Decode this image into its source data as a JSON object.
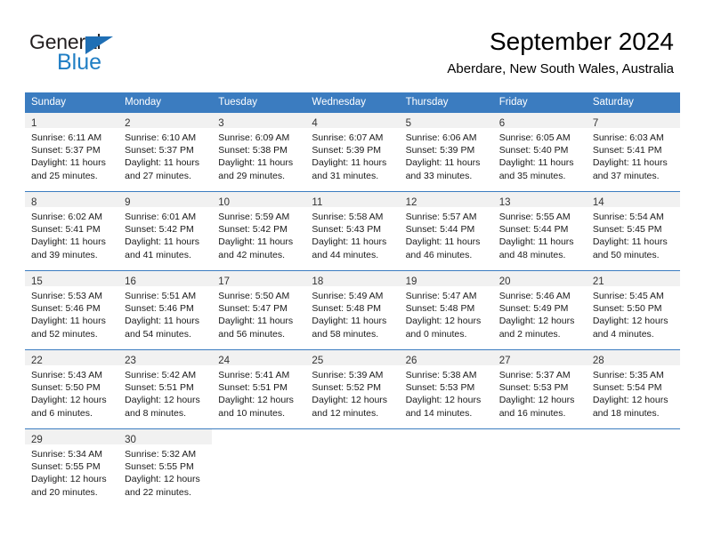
{
  "brand": {
    "name_part1": "General",
    "name_part2": "Blue",
    "triangle_icon": "triangle-icon",
    "accent_color": "#1f7ec4"
  },
  "header": {
    "month_title": "September 2024",
    "location": "Aberdare, New South Wales, Australia"
  },
  "calendar": {
    "header_bg": "#3b7cc0",
    "day_band_bg": "#f1f1f1",
    "weekday_headers": [
      "Sunday",
      "Monday",
      "Tuesday",
      "Wednesday",
      "Thursday",
      "Friday",
      "Saturday"
    ],
    "weeks": [
      [
        {
          "day": "1",
          "sunrise": "Sunrise: 6:11 AM",
          "sunset": "Sunset: 5:37 PM",
          "daylight_line1": "Daylight: 11 hours",
          "daylight_line2": "and 25 minutes."
        },
        {
          "day": "2",
          "sunrise": "Sunrise: 6:10 AM",
          "sunset": "Sunset: 5:37 PM",
          "daylight_line1": "Daylight: 11 hours",
          "daylight_line2": "and 27 minutes."
        },
        {
          "day": "3",
          "sunrise": "Sunrise: 6:09 AM",
          "sunset": "Sunset: 5:38 PM",
          "daylight_line1": "Daylight: 11 hours",
          "daylight_line2": "and 29 minutes."
        },
        {
          "day": "4",
          "sunrise": "Sunrise: 6:07 AM",
          "sunset": "Sunset: 5:39 PM",
          "daylight_line1": "Daylight: 11 hours",
          "daylight_line2": "and 31 minutes."
        },
        {
          "day": "5",
          "sunrise": "Sunrise: 6:06 AM",
          "sunset": "Sunset: 5:39 PM",
          "daylight_line1": "Daylight: 11 hours",
          "daylight_line2": "and 33 minutes."
        },
        {
          "day": "6",
          "sunrise": "Sunrise: 6:05 AM",
          "sunset": "Sunset: 5:40 PM",
          "daylight_line1": "Daylight: 11 hours",
          "daylight_line2": "and 35 minutes."
        },
        {
          "day": "7",
          "sunrise": "Sunrise: 6:03 AM",
          "sunset": "Sunset: 5:41 PM",
          "daylight_line1": "Daylight: 11 hours",
          "daylight_line2": "and 37 minutes."
        }
      ],
      [
        {
          "day": "8",
          "sunrise": "Sunrise: 6:02 AM",
          "sunset": "Sunset: 5:41 PM",
          "daylight_line1": "Daylight: 11 hours",
          "daylight_line2": "and 39 minutes."
        },
        {
          "day": "9",
          "sunrise": "Sunrise: 6:01 AM",
          "sunset": "Sunset: 5:42 PM",
          "daylight_line1": "Daylight: 11 hours",
          "daylight_line2": "and 41 minutes."
        },
        {
          "day": "10",
          "sunrise": "Sunrise: 5:59 AM",
          "sunset": "Sunset: 5:42 PM",
          "daylight_line1": "Daylight: 11 hours",
          "daylight_line2": "and 42 minutes."
        },
        {
          "day": "11",
          "sunrise": "Sunrise: 5:58 AM",
          "sunset": "Sunset: 5:43 PM",
          "daylight_line1": "Daylight: 11 hours",
          "daylight_line2": "and 44 minutes."
        },
        {
          "day": "12",
          "sunrise": "Sunrise: 5:57 AM",
          "sunset": "Sunset: 5:44 PM",
          "daylight_line1": "Daylight: 11 hours",
          "daylight_line2": "and 46 minutes."
        },
        {
          "day": "13",
          "sunrise": "Sunrise: 5:55 AM",
          "sunset": "Sunset: 5:44 PM",
          "daylight_line1": "Daylight: 11 hours",
          "daylight_line2": "and 48 minutes."
        },
        {
          "day": "14",
          "sunrise": "Sunrise: 5:54 AM",
          "sunset": "Sunset: 5:45 PM",
          "daylight_line1": "Daylight: 11 hours",
          "daylight_line2": "and 50 minutes."
        }
      ],
      [
        {
          "day": "15",
          "sunrise": "Sunrise: 5:53 AM",
          "sunset": "Sunset: 5:46 PM",
          "daylight_line1": "Daylight: 11 hours",
          "daylight_line2": "and 52 minutes."
        },
        {
          "day": "16",
          "sunrise": "Sunrise: 5:51 AM",
          "sunset": "Sunset: 5:46 PM",
          "daylight_line1": "Daylight: 11 hours",
          "daylight_line2": "and 54 minutes."
        },
        {
          "day": "17",
          "sunrise": "Sunrise: 5:50 AM",
          "sunset": "Sunset: 5:47 PM",
          "daylight_line1": "Daylight: 11 hours",
          "daylight_line2": "and 56 minutes."
        },
        {
          "day": "18",
          "sunrise": "Sunrise: 5:49 AM",
          "sunset": "Sunset: 5:48 PM",
          "daylight_line1": "Daylight: 11 hours",
          "daylight_line2": "and 58 minutes."
        },
        {
          "day": "19",
          "sunrise": "Sunrise: 5:47 AM",
          "sunset": "Sunset: 5:48 PM",
          "daylight_line1": "Daylight: 12 hours",
          "daylight_line2": "and 0 minutes."
        },
        {
          "day": "20",
          "sunrise": "Sunrise: 5:46 AM",
          "sunset": "Sunset: 5:49 PM",
          "daylight_line1": "Daylight: 12 hours",
          "daylight_line2": "and 2 minutes."
        },
        {
          "day": "21",
          "sunrise": "Sunrise: 5:45 AM",
          "sunset": "Sunset: 5:50 PM",
          "daylight_line1": "Daylight: 12 hours",
          "daylight_line2": "and 4 minutes."
        }
      ],
      [
        {
          "day": "22",
          "sunrise": "Sunrise: 5:43 AM",
          "sunset": "Sunset: 5:50 PM",
          "daylight_line1": "Daylight: 12 hours",
          "daylight_line2": "and 6 minutes."
        },
        {
          "day": "23",
          "sunrise": "Sunrise: 5:42 AM",
          "sunset": "Sunset: 5:51 PM",
          "daylight_line1": "Daylight: 12 hours",
          "daylight_line2": "and 8 minutes."
        },
        {
          "day": "24",
          "sunrise": "Sunrise: 5:41 AM",
          "sunset": "Sunset: 5:51 PM",
          "daylight_line1": "Daylight: 12 hours",
          "daylight_line2": "and 10 minutes."
        },
        {
          "day": "25",
          "sunrise": "Sunrise: 5:39 AM",
          "sunset": "Sunset: 5:52 PM",
          "daylight_line1": "Daylight: 12 hours",
          "daylight_line2": "and 12 minutes."
        },
        {
          "day": "26",
          "sunrise": "Sunrise: 5:38 AM",
          "sunset": "Sunset: 5:53 PM",
          "daylight_line1": "Daylight: 12 hours",
          "daylight_line2": "and 14 minutes."
        },
        {
          "day": "27",
          "sunrise": "Sunrise: 5:37 AM",
          "sunset": "Sunset: 5:53 PM",
          "daylight_line1": "Daylight: 12 hours",
          "daylight_line2": "and 16 minutes."
        },
        {
          "day": "28",
          "sunrise": "Sunrise: 5:35 AM",
          "sunset": "Sunset: 5:54 PM",
          "daylight_line1": "Daylight: 12 hours",
          "daylight_line2": "and 18 minutes."
        }
      ],
      [
        {
          "day": "29",
          "sunrise": "Sunrise: 5:34 AM",
          "sunset": "Sunset: 5:55 PM",
          "daylight_line1": "Daylight: 12 hours",
          "daylight_line2": "and 20 minutes."
        },
        {
          "day": "30",
          "sunrise": "Sunrise: 5:32 AM",
          "sunset": "Sunset: 5:55 PM",
          "daylight_line1": "Daylight: 12 hours",
          "daylight_line2": "and 22 minutes."
        },
        {
          "day": "",
          "sunrise": "",
          "sunset": "",
          "daylight_line1": "",
          "daylight_line2": ""
        },
        {
          "day": "",
          "sunrise": "",
          "sunset": "",
          "daylight_line1": "",
          "daylight_line2": ""
        },
        {
          "day": "",
          "sunrise": "",
          "sunset": "",
          "daylight_line1": "",
          "daylight_line2": ""
        },
        {
          "day": "",
          "sunrise": "",
          "sunset": "",
          "daylight_line1": "",
          "daylight_line2": ""
        },
        {
          "day": "",
          "sunrise": "",
          "sunset": "",
          "daylight_line1": "",
          "daylight_line2": ""
        }
      ]
    ]
  }
}
